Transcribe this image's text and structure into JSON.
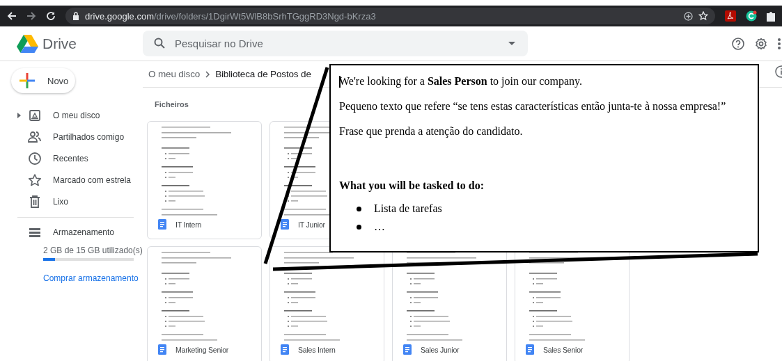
{
  "browser": {
    "url_host": "drive.google.com",
    "url_path": "/drive/folders/1DgirWt5WlB8bSrhTGggRD3Ngd-bKrza3"
  },
  "app": {
    "name": "Drive",
    "search_placeholder": "Pesquisar no Drive"
  },
  "new_button": "Novo",
  "sidebar": {
    "items": [
      {
        "label": "O meu disco",
        "expandable": true
      },
      {
        "label": "Partilhados comigo",
        "expandable": false
      },
      {
        "label": "Recentes",
        "expandable": false
      },
      {
        "label": "Marcado com estrela",
        "expandable": false
      },
      {
        "label": "Lixo",
        "expandable": false
      }
    ],
    "storage": {
      "label": "Armazenamento",
      "usage": "2 GB de 15 GB utilizado(s)",
      "level": 0.13,
      "buy": "Comprar armazenamento"
    }
  },
  "breadcrumb": [
    "O meu disco",
    "Biblioteca de Postos de"
  ],
  "section_title": "Ficheiros",
  "file_rows": [
    [
      {
        "name": "IT Intern"
      },
      {
        "name": "IT Junior"
      }
    ],
    [
      {
        "name": "Marketing Senior"
      },
      {
        "name": "Sales Intern"
      },
      {
        "name": "Sales Junior"
      },
      {
        "name": "Sales Senior"
      }
    ]
  ],
  "callout": {
    "blocks": [
      {
        "kind": "paragraph",
        "text": "We're looking for a **Sales Person** to join our company."
      },
      {
        "kind": "paragraph",
        "text": "Pequeno texto que refere “se tens estas características então junta-te à nossa empresa!”"
      },
      {
        "kind": "paragraph",
        "text": "Frase que prenda a atenção do candidato."
      },
      {
        "kind": "heading",
        "text": "What you will be tasked to do:"
      },
      {
        "kind": "bullet",
        "text": "Lista de tarefas"
      },
      {
        "kind": "bullet",
        "text": "…"
      }
    ]
  }
}
